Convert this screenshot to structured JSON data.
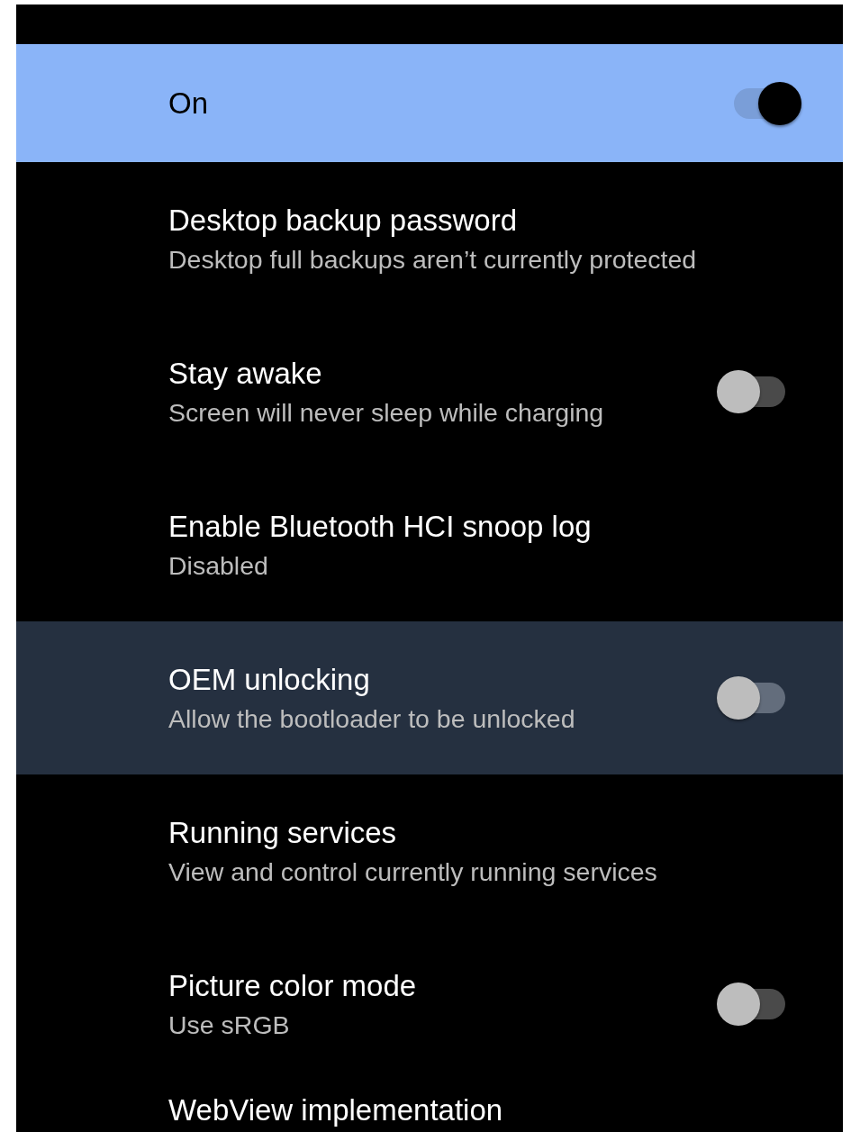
{
  "main_switch": {
    "label": "On",
    "on": true
  },
  "settings": [
    {
      "kind": "plain",
      "title": "Desktop backup password",
      "summary": "Desktop full backups aren’t currently protected",
      "highlighted": false
    },
    {
      "kind": "switch",
      "title": "Stay awake",
      "summary": "Screen will never sleep while charging",
      "on": false,
      "highlighted": false
    },
    {
      "kind": "plain",
      "title": "Enable Bluetooth HCI snoop log",
      "summary": "Disabled",
      "highlighted": false
    },
    {
      "kind": "switch",
      "title": "OEM unlocking",
      "summary": "Allow the bootloader to be unlocked",
      "on": false,
      "highlighted": true
    },
    {
      "kind": "plain",
      "title": "Running services",
      "summary": "View and control currently running services",
      "highlighted": false
    },
    {
      "kind": "switch",
      "title": "Picture color mode",
      "summary": "Use sRGB",
      "on": false,
      "highlighted": false
    },
    {
      "kind": "plain",
      "title": "WebView implementation",
      "highlighted": false
    }
  ]
}
